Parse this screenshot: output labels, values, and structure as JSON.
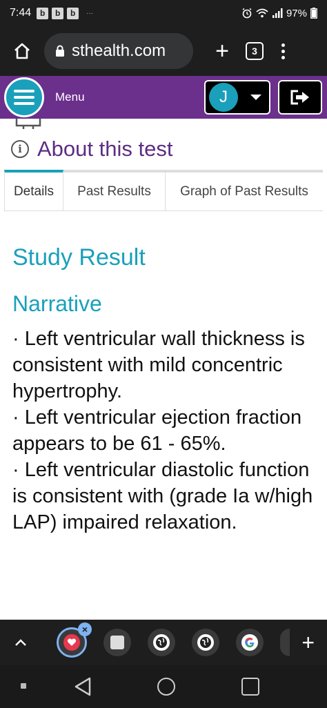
{
  "status_bar": {
    "time": "7:44",
    "notif_letters": [
      "b",
      "b",
      "b"
    ],
    "overflow": "···",
    "battery": "97%"
  },
  "browser": {
    "url": "sthealth.com",
    "new_tab_symbol": "+",
    "tab_count": "3"
  },
  "header": {
    "menu_label": "Menu",
    "user_initial": "J",
    "colors": {
      "purple": "#6b2f8c",
      "teal": "#1aa0bb"
    }
  },
  "page": {
    "about_title": "About this test",
    "info_symbol": "i",
    "tabs": [
      {
        "label": "Details",
        "active": true
      },
      {
        "label": "Past Results",
        "active": false
      },
      {
        "label": "Graph of Past Results",
        "active": false
      }
    ],
    "study_result_heading": "Study Result",
    "narrative_heading": "Narrative",
    "narrative_items": [
      "· Left ventricular wall thickness is consistent with mild concentric hypertrophy.",
      "· Left ventricular ejection fraction appears to be 61 - 65%.",
      "· Left ventricular diastolic function is consistent with (grade Ia w/high LAP) impaired relaxation."
    ]
  },
  "tab_strip": {
    "close_symbol": "×",
    "add_symbol": "+"
  }
}
